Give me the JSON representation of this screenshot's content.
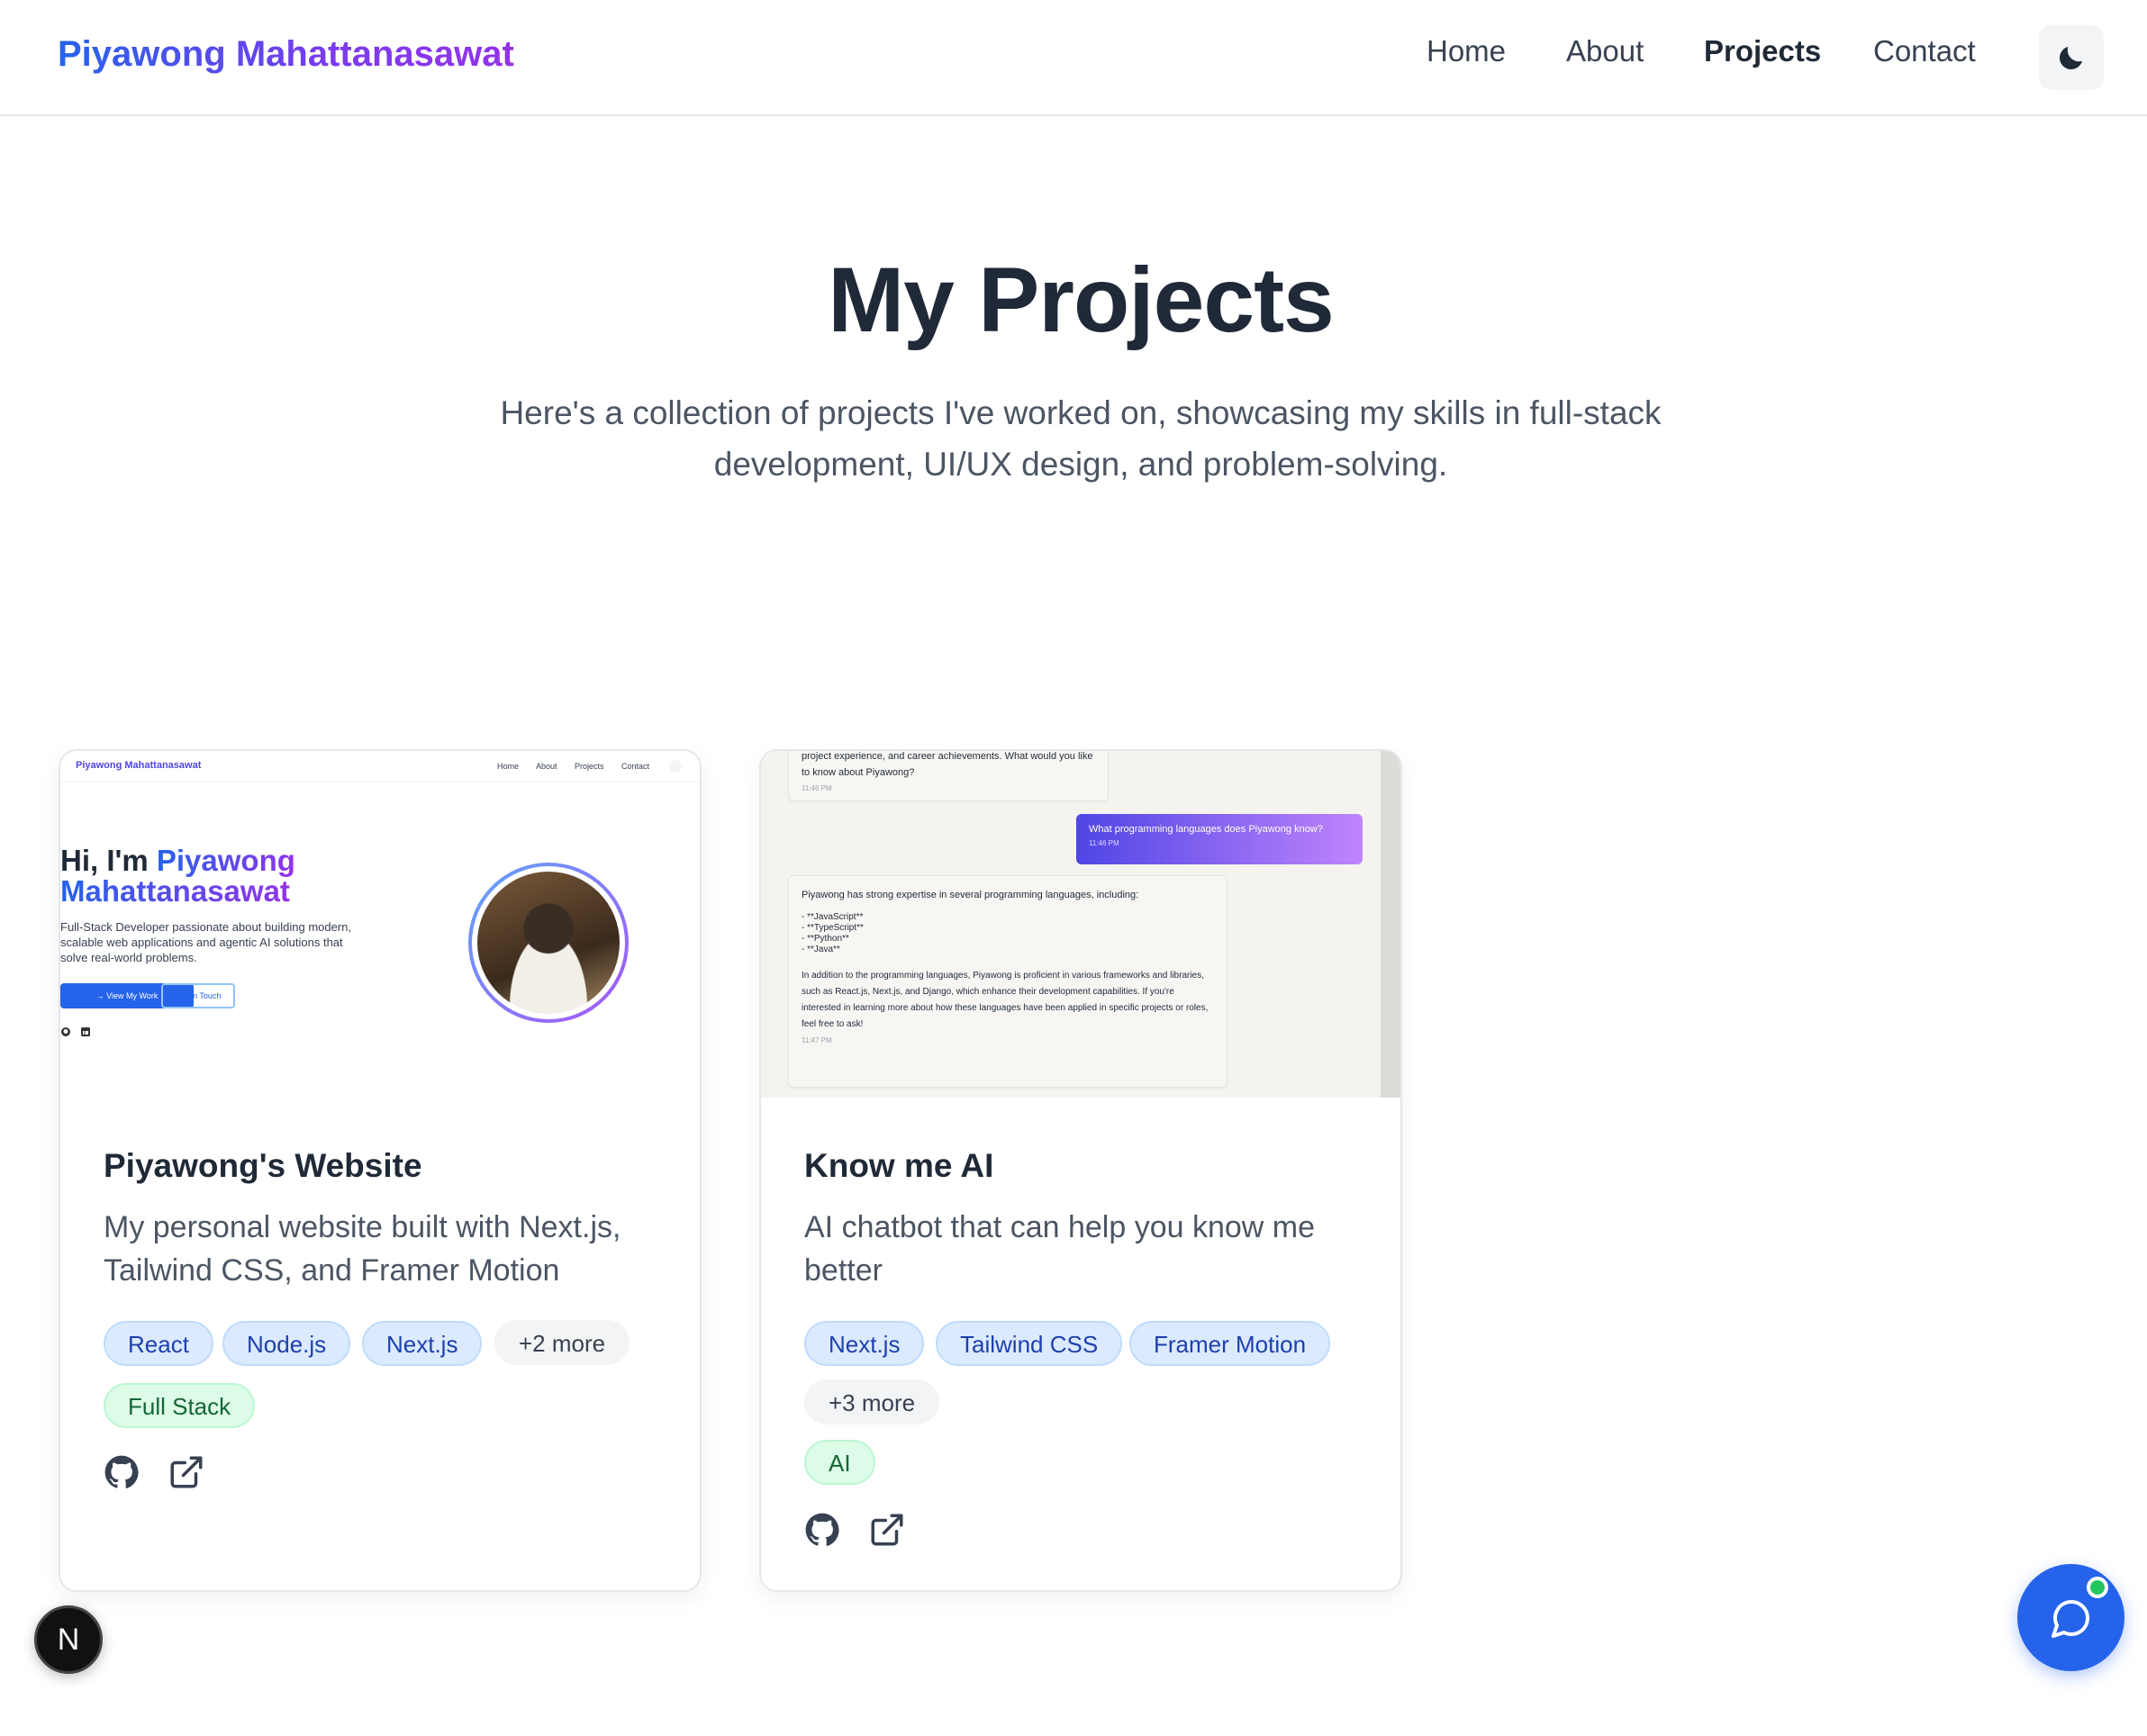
{
  "header": {
    "brand": "Piyawong Mahattanasawat",
    "nav": [
      "Home",
      "About",
      "Projects",
      "Contact"
    ],
    "active_nav": "Projects",
    "theme_icon": "moon-icon"
  },
  "hero": {
    "title": "My Projects",
    "subtitle": "Here's a collection of projects I've worked on, showcasing my skills in full-stack development, UI/UX design, and problem-solving."
  },
  "projects": [
    {
      "title": "Piyawong's Website",
      "description": "My personal website built with Next.js, Tailwind CSS, and Framer Motion",
      "tags": [
        "React",
        "Node.js",
        "Next.js"
      ],
      "more": "+2 more",
      "category": "Full Stack",
      "links": [
        "github-icon",
        "external-link-icon"
      ],
      "preview": {
        "brand": "Piyawong Mahattanasawat",
        "nav": [
          "Home",
          "About",
          "Projects",
          "Contact"
        ],
        "greeting": "Hi, I'm",
        "name_first": "Piyawong",
        "name_last": "Mahattanasawat",
        "description": "Full-Stack Developer passionate about building modern, scalable web applications and agentic AI solutions that solve real-world problems.",
        "primary_button": "View My Work",
        "secondary_button": "Get In Touch"
      }
    },
    {
      "title": "Know me AI",
      "description": "AI chatbot that can help you know me better",
      "tags": [
        "Next.js",
        "Tailwind CSS",
        "Framer Motion"
      ],
      "more": "+3 more",
      "category": "AI",
      "links": [
        "github-icon",
        "external-link-icon"
      ],
      "preview": {
        "prev_message_tail": "project experience, and career achievements. What would you like to know about Piyawong?",
        "prev_time": "11:46 PM",
        "user_message": "What programming languages does Piyawong know?",
        "user_time": "11:46 PM",
        "reply_intro": "Piyawong has strong expertise in several programming languages, including:",
        "reply_list": [
          "- **JavaScript**",
          "- **TypeScript**",
          "- **Python**",
          "- **Java**"
        ],
        "reply_body": "In addition to the programming languages, Piyawong is proficient in various frameworks and libraries, such as React.js, Next.js, and Django, which enhance their development capabilities. If you're interested in learning more about how these languages have been applied in specific projects or roles, feel free to ask!",
        "reply_time": "11:47 PM"
      }
    }
  ],
  "floating": {
    "dev_badge": "N",
    "chat_icon": "chat-bubble-icon",
    "online_indicator_color": "#22c55e"
  },
  "colors": {
    "accent": "#2563eb",
    "brand_gradient_end": "#9333ea",
    "tag_bg": "#dbeafe",
    "category_bg": "#dcfce7"
  }
}
